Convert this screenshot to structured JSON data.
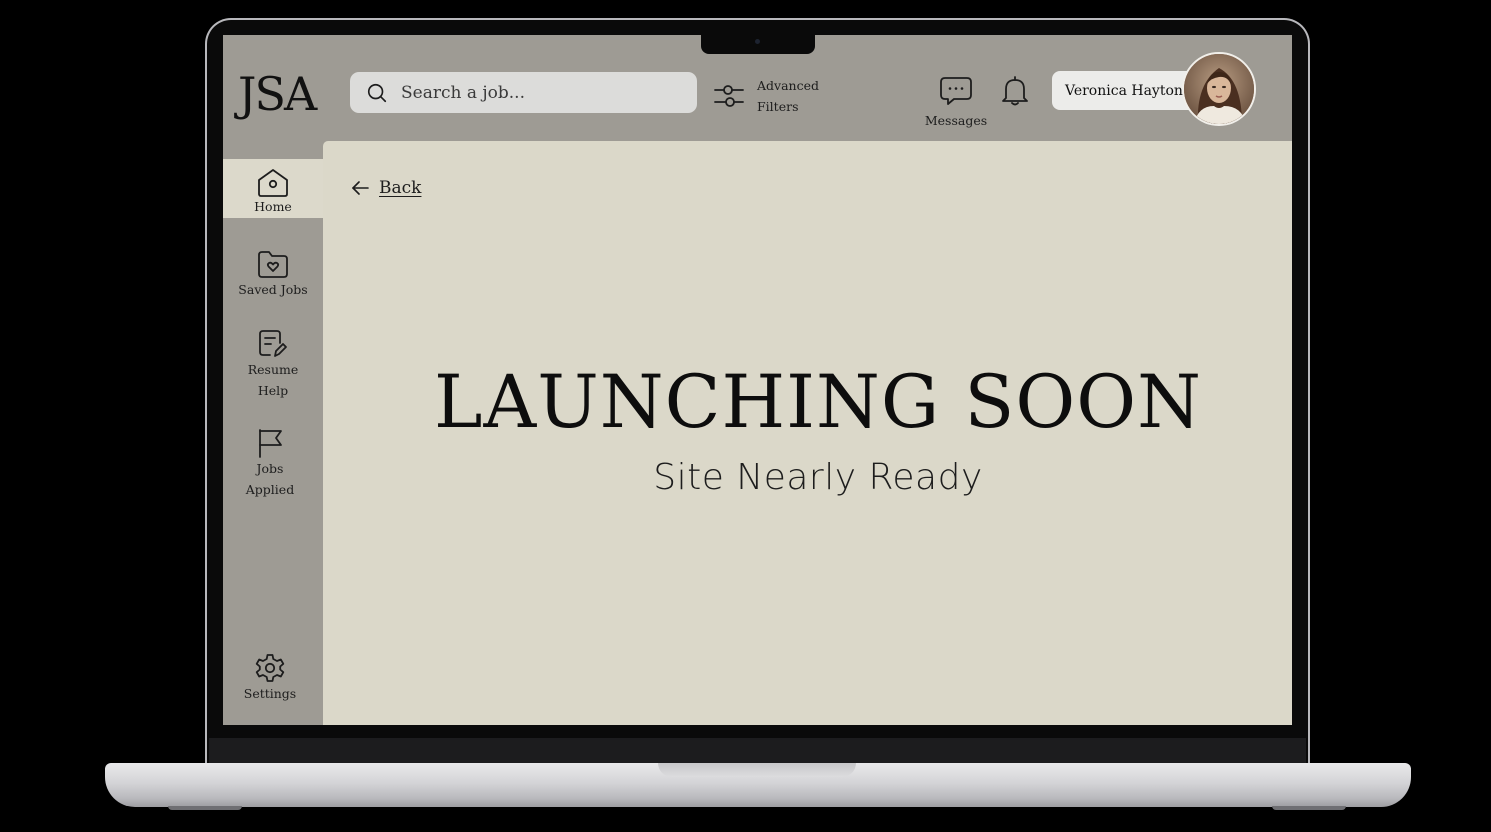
{
  "app": {
    "logo": "JSA"
  },
  "header": {
    "search": {
      "placeholder": "Search a job..."
    },
    "filters": {
      "line1": "Advanced",
      "line2": "Filters",
      "icon": "sliders-icon"
    },
    "messages": {
      "label": "Messages",
      "icon": "chat-bubble-icon"
    },
    "notifications": {
      "icon": "bell-icon"
    },
    "user": {
      "name": "Veronica Hayton"
    }
  },
  "sidebar": {
    "items": [
      {
        "label": "Home",
        "icon": "home-icon",
        "active": true
      },
      {
        "label": "Saved Jobs",
        "icon": "folder-heart-icon"
      },
      {
        "label_line1": "Resume",
        "label_line2": "Help",
        "icon": "document-edit-icon"
      },
      {
        "label_line1": "Jobs",
        "label_line2": "Applied",
        "icon": "flag-icon"
      },
      {
        "label": "Settings",
        "icon": "gear-icon"
      }
    ]
  },
  "main": {
    "back_label": "Back",
    "headline": "LAUNCHING SOON",
    "subheadline": "Site Nearly Ready"
  },
  "colors": {
    "frame": "#9e9b94",
    "content_bg": "#dbd8c9",
    "active_nav": "#dcd9cb",
    "search_bg": "#dcdcda",
    "text": "#111111"
  }
}
